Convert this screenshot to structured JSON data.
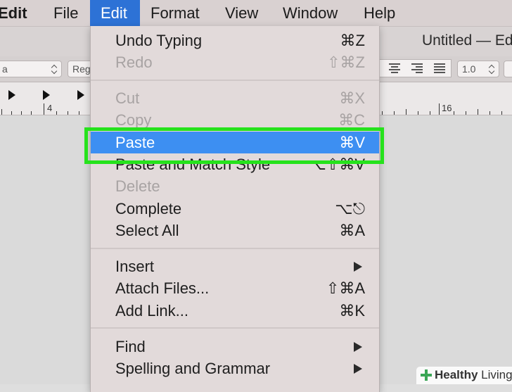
{
  "menubar": {
    "app": "Edit",
    "items": [
      "File",
      "Edit",
      "Format",
      "View",
      "Window",
      "Help"
    ]
  },
  "window": {
    "title": "Untitled — Ed"
  },
  "toolbar": {
    "font_family": "a",
    "font_style": "Reg",
    "line_spacing": "1.0"
  },
  "ruler": {
    "labels": [
      "4",
      "16"
    ]
  },
  "edit_menu": {
    "items": [
      {
        "label": "Undo Typing",
        "shortcut": "⌘Z"
      },
      {
        "label": "Redo",
        "shortcut": "⇧⌘Z"
      },
      {
        "label": "Cut",
        "shortcut": "⌘X"
      },
      {
        "label": "Copy",
        "shortcut": "⌘C"
      },
      {
        "label": "Paste",
        "shortcut": "⌘V"
      },
      {
        "label": "Paste and Match Style",
        "shortcut": "⌥⇧⌘V"
      },
      {
        "label": "Delete",
        "shortcut": ""
      },
      {
        "label": "Complete",
        "shortcut": "⌥⎋"
      },
      {
        "label": "Select All",
        "shortcut": "⌘A"
      },
      {
        "label": "Insert",
        "shortcut": ""
      },
      {
        "label": "Attach Files...",
        "shortcut": "⇧⌘A"
      },
      {
        "label": "Add Link...",
        "shortcut": "⌘K"
      },
      {
        "label": "Find",
        "shortcut": ""
      },
      {
        "label": "Spelling and Grammar",
        "shortcut": ""
      }
    ]
  },
  "colors": {
    "menu_highlight": "#3d8ff2",
    "menubar_active": "#2d72d6",
    "callout_border": "#26e21c"
  },
  "watermark": {
    "brand_bold": "Healthy",
    "brand_rest": " Living"
  }
}
